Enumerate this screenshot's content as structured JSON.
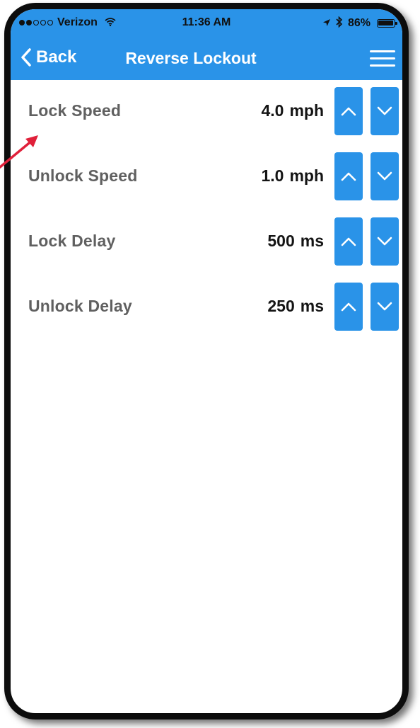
{
  "status_bar": {
    "signal_dots_filled": 2,
    "signal_dots_total": 5,
    "carrier": "Verizon",
    "time": "11:36 AM",
    "battery": "86%",
    "icons": [
      "wifi-icon",
      "location-arrow-icon",
      "bluetooth-icon",
      "battery-icon"
    ]
  },
  "nav": {
    "back_label": "Back",
    "title": "Reverse Lockout",
    "menu_icon": "hamburger-menu-icon"
  },
  "settings": [
    {
      "label": "Lock Speed",
      "value": "4.0",
      "unit": "mph"
    },
    {
      "label": "Unlock Speed",
      "value": "1.0",
      "unit": "mph"
    },
    {
      "label": "Lock Delay",
      "value": "500",
      "unit": "ms"
    },
    {
      "label": "Unlock Delay",
      "value": "250",
      "unit": "ms"
    }
  ],
  "colors": {
    "accent": "#2a93e8",
    "label_text": "#606060",
    "value_text": "#141414",
    "annotation_arrow": "#e0203a",
    "frame": "#0c0c0c"
  }
}
